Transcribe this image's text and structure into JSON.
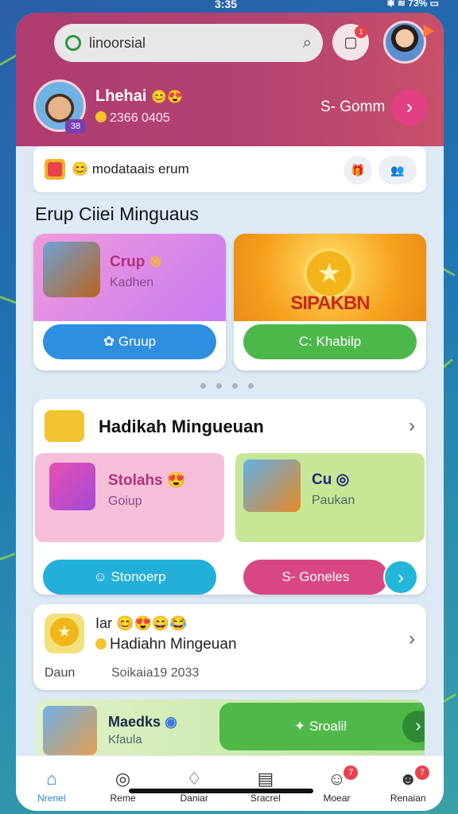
{
  "status": {
    "time": "3:35",
    "battery": "73%"
  },
  "header": {
    "search_placeholder": "linoorsial",
    "notif_badge": "1",
    "user": {
      "name": "Lhehai",
      "coins": "2366 0405",
      "level": "38",
      "action_label": "S- Gomm"
    }
  },
  "notice": {
    "text": "modataais erum"
  },
  "section": {
    "title": "Erup Ciiei Minguaus"
  },
  "promo_cards": [
    {
      "title": "Crup",
      "subtitle": "Kadhen",
      "button": "Gruup",
      "button_color": "#2e8ee0"
    },
    {
      "banner": "SIPAKBN",
      "button": "C: Khabilp",
      "button_color": "#4cb84a"
    }
  ],
  "weekly": {
    "title": "Hadikah Mingueuan",
    "cards": [
      {
        "title": "Stolahs",
        "subtitle": "Goiup",
        "button": "Stonoerp",
        "button_color": "#23b0d8"
      },
      {
        "title": "Cu",
        "subtitle": "Paukan",
        "button": "S- Goneles",
        "button_color": "#d94684"
      }
    ]
  },
  "reward": {
    "heading": "Iar",
    "title": "Hadiahn Mingeuan",
    "label": "Daun",
    "date": "Soikaia19 2033"
  },
  "bottom": {
    "title": "Maedks",
    "subtitle": "Kfaula",
    "button": "Sroalil"
  },
  "nav": [
    {
      "label": "Nrenel",
      "icon": "home-icon",
      "active": true
    },
    {
      "label": "Reme",
      "icon": "steering-icon"
    },
    {
      "label": "Daniar",
      "icon": "bag-icon"
    },
    {
      "label": "Sracrel",
      "icon": "document-icon"
    },
    {
      "label": "Moear",
      "icon": "person-icon",
      "badge": "7"
    },
    {
      "label": "Renaian",
      "icon": "profile-icon",
      "badge": "7"
    }
  ],
  "colors": {
    "header": "#b03c70",
    "accent_pink": "#e33f83",
    "nav_active": "#2a82e0"
  }
}
